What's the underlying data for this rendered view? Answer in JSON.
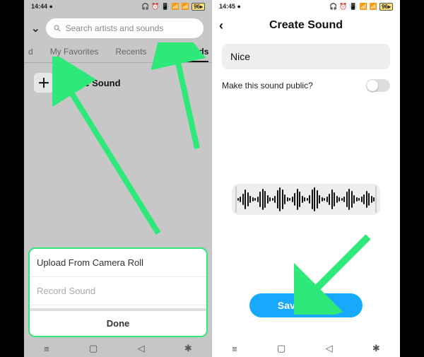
{
  "left": {
    "status": {
      "time": "14:44",
      "battery": "96"
    },
    "search_placeholder": "Search artists and sounds",
    "tabs": {
      "featured_truncated": "d",
      "favorites": "My Favorites",
      "recents": "Recents",
      "my_sounds": "My Sounds"
    },
    "create_sound": "Create Sound",
    "sheet": {
      "upload": "Upload From Camera Roll",
      "record": "Record Sound",
      "done": "Done"
    }
  },
  "right": {
    "status": {
      "time": "14:45",
      "battery": "96"
    },
    "title": "Create Sound",
    "name_value": "Nice",
    "public_label": "Make this sound public?",
    "save": "Save Sound"
  }
}
